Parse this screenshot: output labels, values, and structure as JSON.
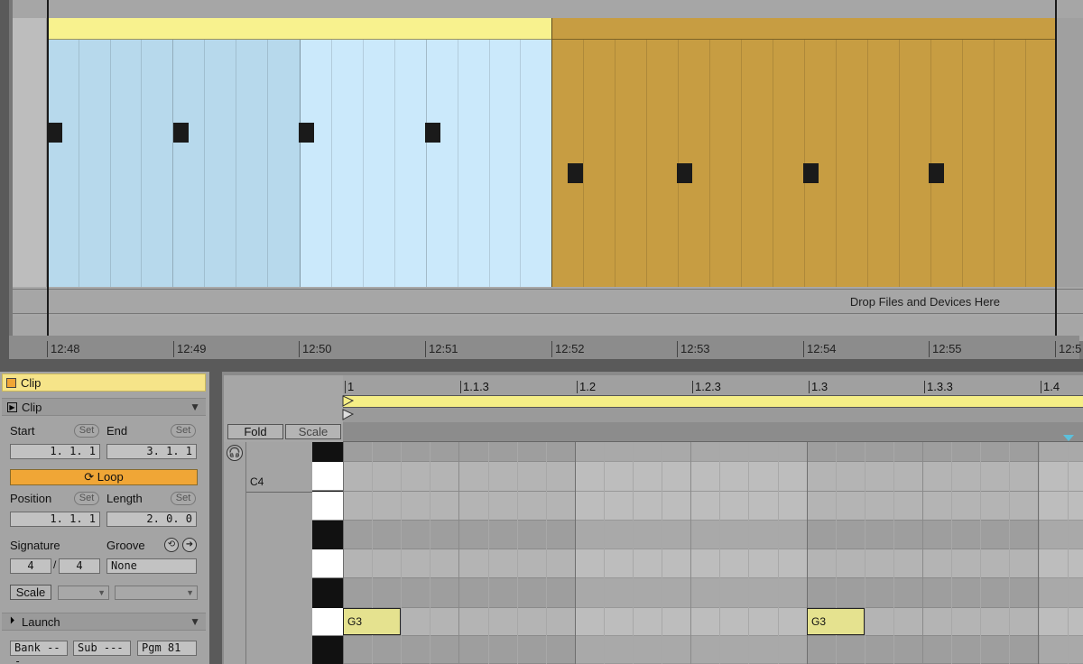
{
  "arrangement": {
    "drop_zone_text": "Drop Files and Devices Here",
    "timeline_ticks": [
      "12:48",
      "12:49",
      "12:50",
      "12:51",
      "12:52",
      "12:53",
      "12:54",
      "12:55",
      "12:5"
    ],
    "colors": {
      "clip_blue": "#b7d9ec",
      "clip_lightblue": "#cbe9fb",
      "clip_gold": "#c79d42",
      "clip_header_yellow": "#f8f28e"
    }
  },
  "clip_view": {
    "title": "Clip",
    "section_clip": {
      "label": "Clip",
      "start_label": "Start",
      "end_label": "End",
      "set_label": "Set",
      "start_value": "1.  1.  1",
      "end_value": "3.  1.  1",
      "loop_label": "Loop",
      "position_label": "Position",
      "length_label": "Length",
      "position_value": "1.  1.  1",
      "length_value": "2.  0.  0",
      "signature_label": "Signature",
      "groove_label": "Groove",
      "sig_num": "4",
      "sig_den": "4",
      "groove_value": "None",
      "scale_label": "Scale"
    },
    "section_launch": {
      "label": "Launch",
      "bank": "Bank ---",
      "sub": "Sub ---",
      "pgm": "Pgm 81"
    }
  },
  "midi_editor": {
    "ruler_marks": [
      "1",
      "1.1.3",
      "1.2",
      "1.2.3",
      "1.3",
      "1.3.3",
      "1.4"
    ],
    "fold_label": "Fold",
    "scale_label": "Scale",
    "octave_label": "C4",
    "notes": [
      {
        "pitch": "G3",
        "start_beat": 1.0,
        "length_beats": 0.25
      },
      {
        "pitch": "G3",
        "start_beat": 3.0,
        "length_beats": 0.25
      }
    ]
  }
}
